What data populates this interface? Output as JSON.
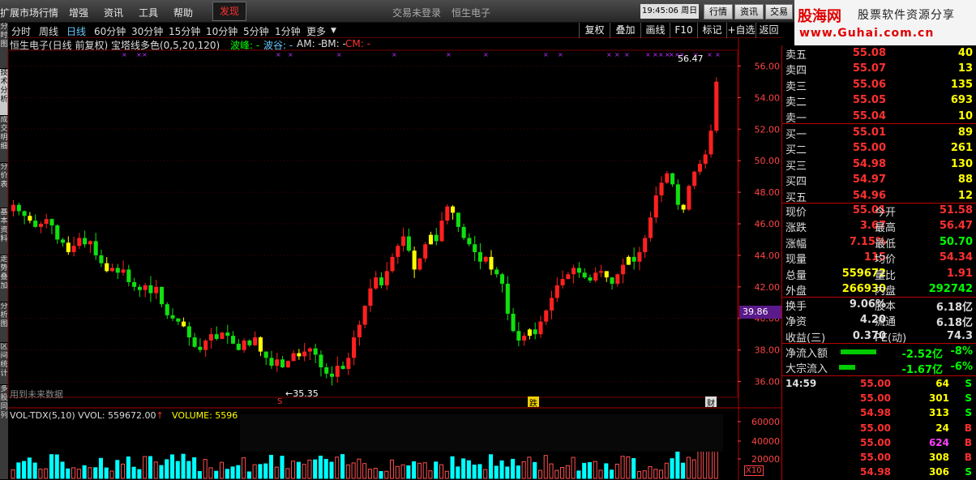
{
  "menu": {
    "items": [
      "扩展市场行情",
      "增强",
      "资讯",
      "工具",
      "帮助"
    ],
    "discover": "发现",
    "trade_status": "交易未登录",
    "stock_name": "恒生电子",
    "time": "19:45:06",
    "weekday": "周日",
    "right_buttons": [
      "行情",
      "资讯",
      "交易"
    ]
  },
  "logo": {
    "brand": "股海网",
    "slogan": "股票软件资源分享",
    "url": "www.Guhai.com.cn"
  },
  "side_tabs": [
    "分时图",
    "技术分析",
    "成交明细",
    "分价表",
    "基本资料",
    "走势叠加",
    "分析图",
    "区间统计",
    "多股同列"
  ],
  "periods": [
    "分时",
    "周线",
    "日线",
    "60分钟",
    "30分钟",
    "15分钟",
    "10分钟",
    "5分钟",
    "1分钟",
    "更多"
  ],
  "active_period": "日线",
  "toolbar": [
    "复权",
    "叠加",
    "画线",
    "F10",
    "标记",
    "+自选",
    "返回"
  ],
  "indicator": {
    "title": "恒生电子(日线 前复权) 宝塔线多色(0,5,20,120)",
    "wave_peak": "波峰: -",
    "wave_valley": "波谷: -",
    "am": "AM: -",
    "bm": "BM: -",
    "cm": "CM: -"
  },
  "colors": {
    "up": "#ff2020",
    "down": "#10e010",
    "yellow": "#ffff00",
    "grid": "#500000",
    "axis": "#ff4040",
    "cyan": "#00ffff"
  },
  "price_axis": {
    "labels": [
      "56.00",
      "54.00",
      "52.00",
      "50.00",
      "48.00",
      "46.00",
      "44.00",
      "42.00",
      "40.00",
      "38.00",
      "36.00"
    ],
    "current": "39.86"
  },
  "annotations": {
    "high": "56.47",
    "low": "35.35",
    "future_data": "用到未来数据",
    "mark_s": "S",
    "mark_die": "跌",
    "mark_cai": "财"
  },
  "vol": {
    "title": "VOL-TDX(5,10) VVOL: 559672.00",
    "arrow": "↑",
    "volume": "VOLUME: 5596",
    "axis": [
      "60000",
      "40000",
      "20000"
    ],
    "unit": "X10"
  },
  "quote": {
    "asks": [
      {
        "label": "卖五",
        "price": "55.08",
        "vol": "40"
      },
      {
        "label": "卖四",
        "price": "55.07",
        "vol": "13"
      },
      {
        "label": "卖三",
        "price": "55.06",
        "vol": "135"
      },
      {
        "label": "卖二",
        "price": "55.05",
        "vol": "693"
      },
      {
        "label": "卖一",
        "price": "55.04",
        "vol": "10"
      }
    ],
    "bids": [
      {
        "label": "买一",
        "price": "55.01",
        "vol": "89"
      },
      {
        "label": "买二",
        "price": "55.00",
        "vol": "261"
      },
      {
        "label": "买三",
        "price": "54.98",
        "vol": "130"
      },
      {
        "label": "买四",
        "price": "54.97",
        "vol": "88"
      },
      {
        "label": "买五",
        "price": "54.96",
        "vol": "12"
      }
    ],
    "stats": [
      {
        "l1": "现价",
        "v1": "55.01",
        "l2": "今开",
        "v2": "51.58"
      },
      {
        "l1": "涨跌",
        "v1": "3.67",
        "l2": "最高",
        "v2": "56.47"
      },
      {
        "l1": "涨幅",
        "v1": "7.15%",
        "l2": "最低",
        "v2": "50.70"
      },
      {
        "l1": "现量",
        "v1": "115",
        "l2": "均价",
        "v2": "54.34"
      },
      {
        "l1": "总量",
        "v1": "559672",
        "l2": "量比",
        "v2": "1.91"
      },
      {
        "l1": "外盘",
        "v1": "266930",
        "l2": "内盘",
        "v2": "292742"
      }
    ],
    "stats2": [
      {
        "l1": "换手",
        "v1": "9.06%",
        "l2": "股本",
        "v2": "6.18亿"
      },
      {
        "l1": "净资",
        "v1": "4.20",
        "l2": "流通",
        "v2": "6.18亿"
      },
      {
        "l1": "收益(三)",
        "v1": "0.370",
        "l2": "PE(动)",
        "v2": "74.3"
      }
    ],
    "flows": [
      {
        "label": "净流入额",
        "value": "-2.52亿",
        "pct": "-8%"
      },
      {
        "label": "大宗流入",
        "value": "-1.67亿",
        "pct": "-6%"
      }
    ],
    "ticks": [
      {
        "time": "14:59",
        "price": "55.00",
        "vol": "64",
        "side": "S"
      },
      {
        "time": "",
        "price": "55.00",
        "vol": "301",
        "side": "S"
      },
      {
        "time": "",
        "price": "54.98",
        "vol": "313",
        "side": "S"
      },
      {
        "time": "",
        "price": "55.00",
        "vol": "24",
        "side": "B"
      },
      {
        "time": "",
        "price": "55.00",
        "vol": "624",
        "side": "B"
      },
      {
        "time": "",
        "price": "55.00",
        "vol": "308",
        "side": "B"
      },
      {
        "time": "",
        "price": "54.98",
        "vol": "306",
        "side": "S"
      }
    ]
  },
  "chart_data": {
    "type": "candlestick",
    "ylim": [
      35,
      57
    ],
    "closes": [
      47.2,
      46.8,
      46.5,
      46.2,
      45.8,
      46.0,
      46.3,
      45.9,
      45.0,
      44.8,
      44.2,
      44.6,
      45.1,
      44.7,
      44.9,
      44.0,
      43.5,
      43.0,
      43.2,
      42.9,
      43.1,
      42.3,
      42.0,
      41.8,
      42.1,
      41.6,
      42.0,
      40.9,
      40.2,
      40.0,
      39.8,
      39.5,
      38.8,
      38.2,
      38.0,
      38.6,
      39.0,
      38.7,
      39.1,
      38.9,
      38.4,
      38.0,
      38.6,
      38.3,
      38.8,
      37.9,
      37.5,
      37.0,
      37.4,
      36.9,
      37.3,
      37.8,
      37.6,
      37.9,
      38.1,
      37.7,
      36.9,
      36.5,
      36.3,
      37.0,
      36.8,
      37.5,
      38.8,
      39.6,
      40.8,
      41.9,
      42.6,
      42.1,
      43.0,
      43.9,
      44.6,
      45.2,
      44.3,
      43.1,
      43.8,
      44.7,
      45.3,
      44.9,
      46.2,
      47.1,
      46.7,
      45.8,
      45.1,
      44.7,
      44.2,
      43.6,
      43.9,
      43.1,
      42.8,
      42.2,
      40.3,
      39.2,
      38.6,
      38.9,
      39.3,
      39.0,
      39.8,
      40.5,
      41.3,
      42.1,
      42.5,
      42.8,
      43.2,
      42.9,
      42.6,
      42.4,
      42.9,
      43.0,
      42.6,
      42.2,
      42.8,
      43.4,
      43.9,
      43.6,
      44.2,
      45.1,
      46.4,
      47.8,
      48.6,
      49.2,
      48.5,
      47.2,
      46.9,
      48.4,
      49.3,
      49.8,
      50.4,
      51.9,
      55.01
    ]
  }
}
